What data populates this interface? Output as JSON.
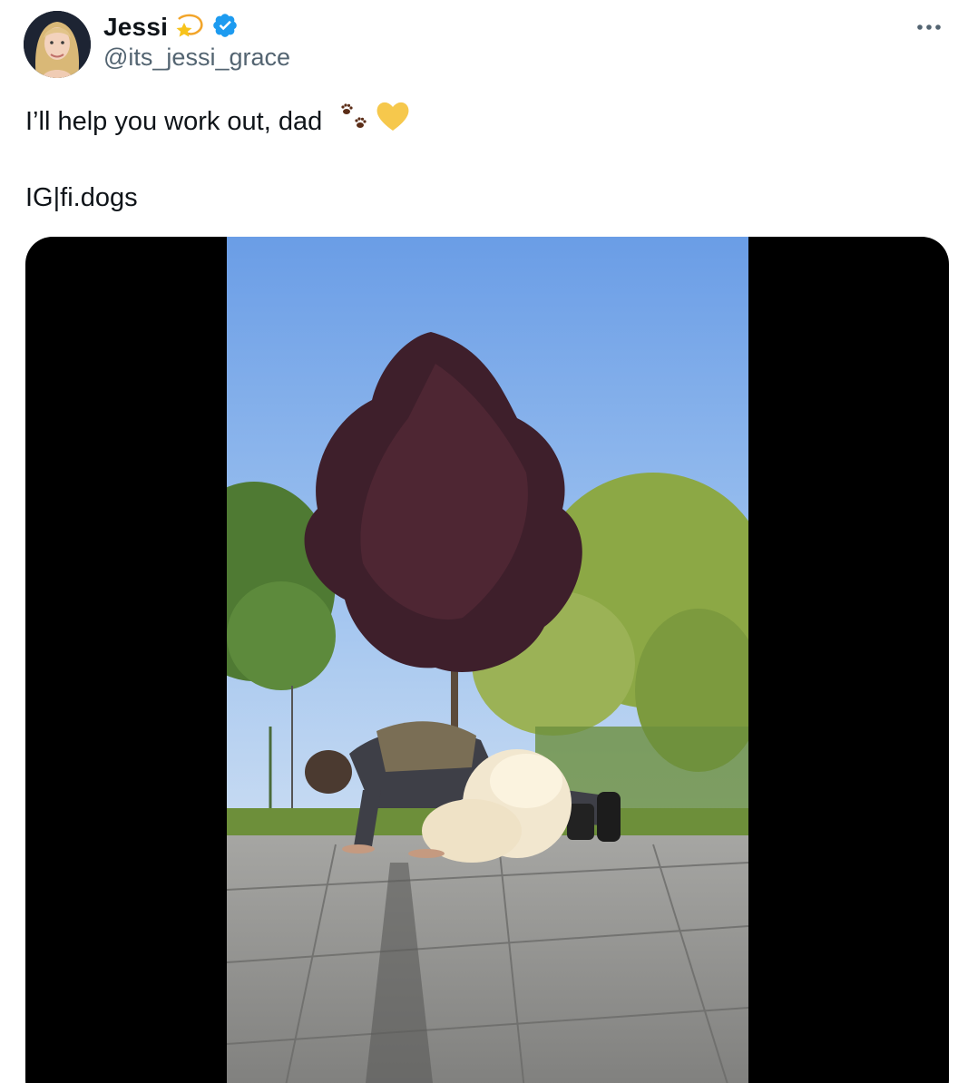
{
  "author": {
    "name": "Jessi",
    "handle": "@its_jessi_grace",
    "name_emoji": "dizzy-star-emoji",
    "verified": true,
    "verified_color": "#1d9bf0"
  },
  "tweet": {
    "line1": "I’ll help you work out, dad",
    "line1_emojis": [
      "paw-prints-emoji",
      "yellow-heart-emoji"
    ],
    "line2": "IG|fi.dogs"
  },
  "media": {
    "type": "video",
    "description_icon": "video-thumbnail"
  },
  "colors": {
    "text": "#0f1419",
    "secondary": "#536471",
    "media_background": "#000000"
  }
}
